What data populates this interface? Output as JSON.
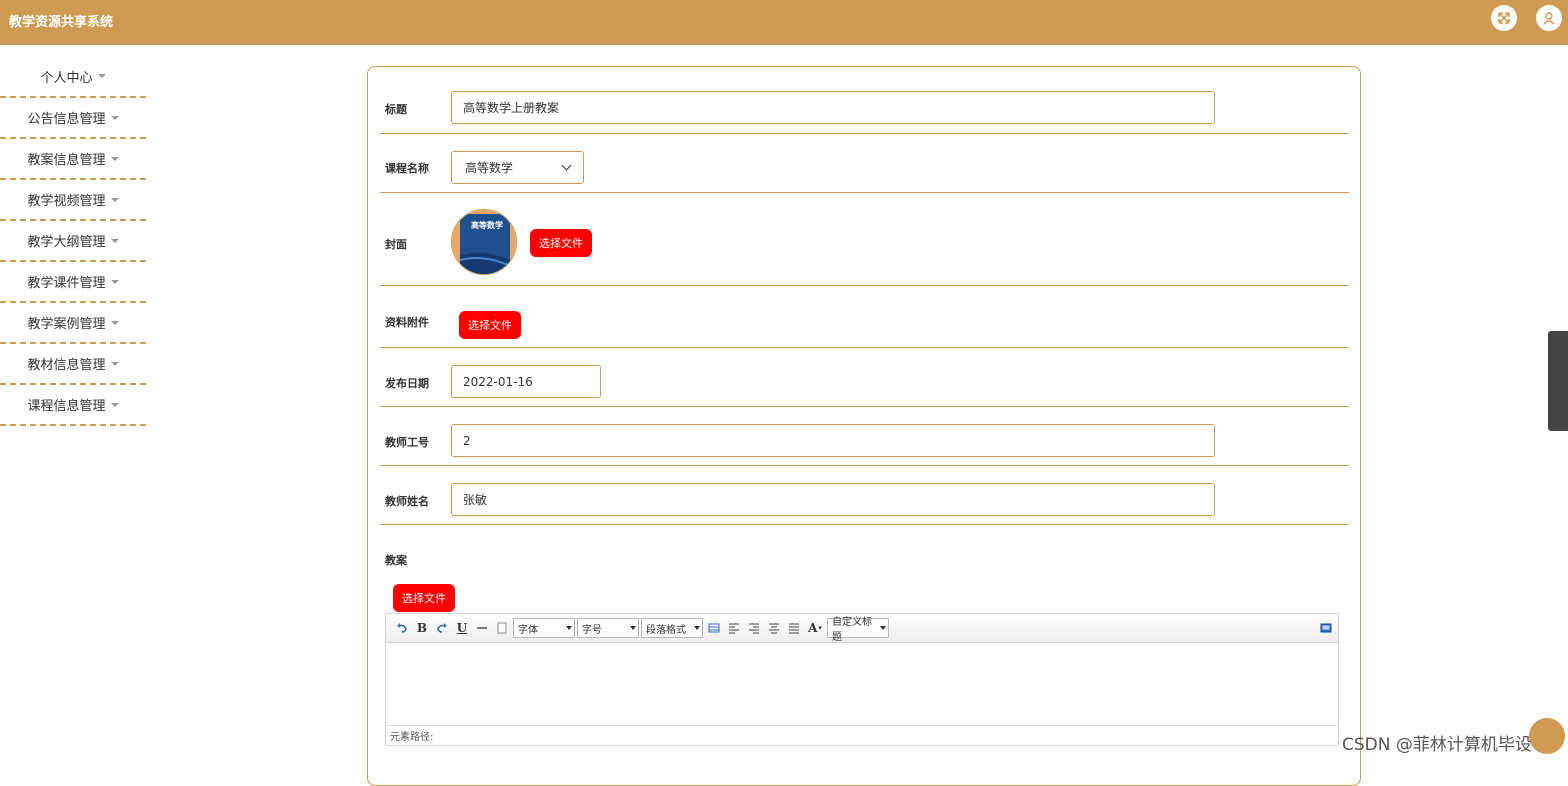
{
  "header": {
    "app_title": "教学资源共享系统"
  },
  "sidebar": {
    "items": [
      {
        "label": "个人中心"
      },
      {
        "label": "公告信息管理"
      },
      {
        "label": "教案信息管理"
      },
      {
        "label": "教学视频管理"
      },
      {
        "label": "教学大纲管理"
      },
      {
        "label": "教学课件管理"
      },
      {
        "label": "教学案例管理"
      },
      {
        "label": "教材信息管理"
      },
      {
        "label": "课程信息管理"
      }
    ]
  },
  "form": {
    "title": {
      "label": "标题",
      "value": "高等数学上册教案"
    },
    "course": {
      "label": "课程名称",
      "value": "高等数学"
    },
    "cover": {
      "label": "封面",
      "button": "选择文件",
      "image_text": "高等数学"
    },
    "attachment": {
      "label": "资料附件",
      "button": "选择文件"
    },
    "publish_date": {
      "label": "发布日期",
      "value": "2022-01-16"
    },
    "teacher_id": {
      "label": "教师工号",
      "value": "2"
    },
    "teacher_name": {
      "label": "教师姓名",
      "value": "张敏"
    },
    "lesson_plan": {
      "label": "教案",
      "button": "选择文件"
    }
  },
  "editor": {
    "font_label": "字体",
    "size_label": "字号",
    "paragraph_label": "段落格式",
    "custom_title_label": "自定义标题",
    "path_label": "元素路径:",
    "bold_glyph": "B",
    "underline_glyph": "U",
    "color_glyph": "A"
  },
  "watermark": "CSDN @菲林计算机毕设",
  "colors": {
    "accent": "#cf9a52",
    "button_red": "#fe0000"
  }
}
